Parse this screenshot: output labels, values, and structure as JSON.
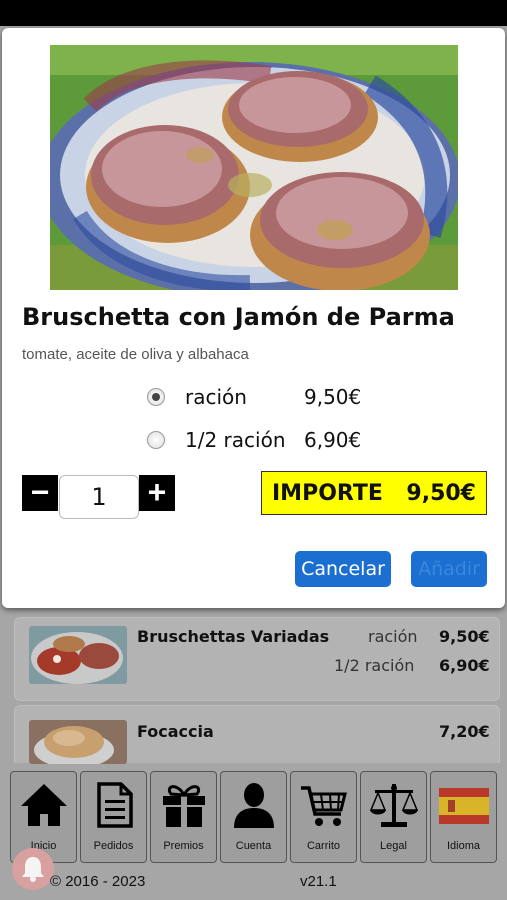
{
  "modal": {
    "title": "Bruschetta con Jamón de Parma",
    "description": "tomate, aceite de oliva y albahaca",
    "options": [
      {
        "label": "ración",
        "price": "9,50€",
        "selected": true
      },
      {
        "label": "1/2 ración",
        "price": "6,90€",
        "selected": false
      }
    ],
    "quantity": "1",
    "minus": "−",
    "plus": "+",
    "importe_label": "IMPORTE",
    "importe_value": "9,50€",
    "cancel_label": "Cancelar",
    "add_label": "Añadir"
  },
  "menu": {
    "items": [
      {
        "name": "Bruschettas Variadas",
        "options": [
          {
            "label": "ración",
            "price": "9,50€"
          },
          {
            "label": "1/2 ración",
            "price": "6,90€"
          }
        ]
      },
      {
        "name": "Focaccia",
        "price": "7,20€"
      }
    ]
  },
  "nav": {
    "items": [
      {
        "label": "Inicio",
        "icon": "home-icon"
      },
      {
        "label": "Pedidos",
        "icon": "document-icon"
      },
      {
        "label": "Premios",
        "icon": "gift-icon"
      },
      {
        "label": "Cuenta",
        "icon": "user-icon"
      },
      {
        "label": "Carrito",
        "icon": "cart-icon"
      },
      {
        "label": "Legal",
        "icon": "scales-icon"
      },
      {
        "label": "Idioma",
        "icon": "spain-flag-icon"
      }
    ]
  },
  "footer": {
    "copyright": "© 2016 - 2023",
    "version": "v21.1"
  },
  "colors": {
    "button_blue": "#1a6fd0",
    "importe_yellow": "#ffff00"
  }
}
